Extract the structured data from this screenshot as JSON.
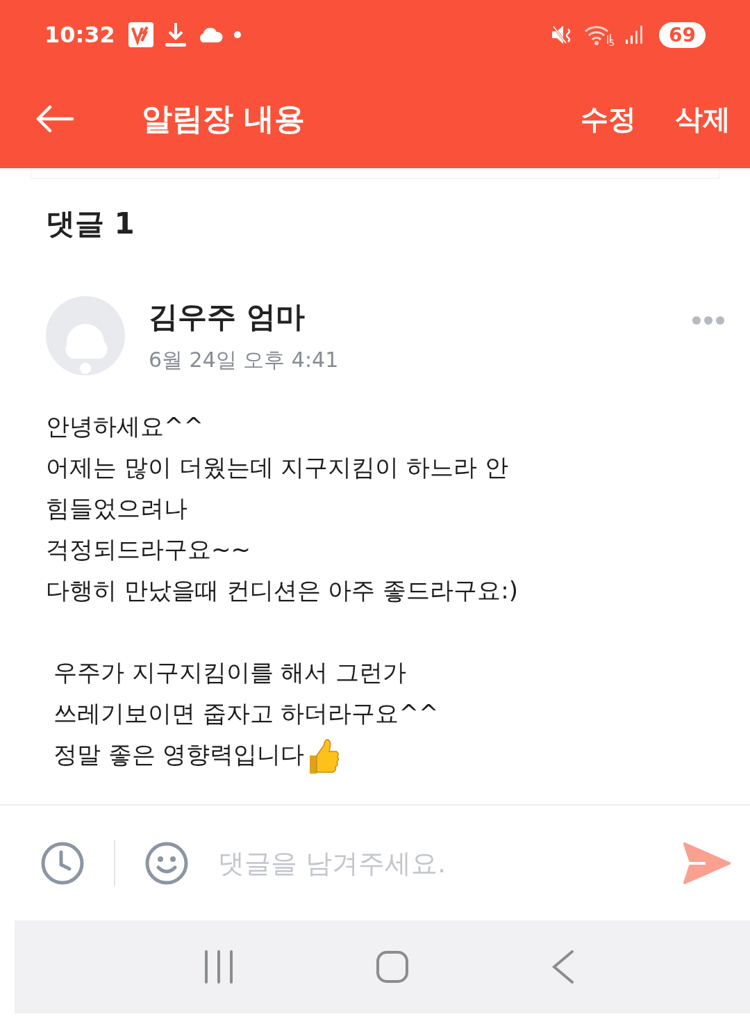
{
  "status_bar": {
    "time": "10:32",
    "battery": "69",
    "wifi_badge": "5"
  },
  "header": {
    "title": "알림장 내용",
    "actions": [
      "수정",
      "삭제"
    ]
  },
  "comments": {
    "heading": "댓글 1",
    "items": [
      {
        "author": "김우주 엄마",
        "date": "6월 24일 오후 4:41",
        "lines": [
          {
            "kind": "text",
            "text": "안녕하세요^^"
          },
          {
            "kind": "text",
            "text": "어제는 많이 더웠는데 지구지킴이 하느라 안"
          },
          {
            "kind": "text",
            "text": "힘들었으려나"
          },
          {
            "kind": "text",
            "text": "걱정되드라구요~~"
          },
          {
            "kind": "text",
            "text": "다행히 만났을때 컨디션은 아주 좋드라구요:)"
          },
          {
            "kind": "blank"
          },
          {
            "kind": "text",
            "text": " 우주가 지구지킴이를 해서 그런가"
          },
          {
            "kind": "text",
            "text": " 쓰레기보이면 줍자고 하더라구요^^"
          },
          {
            "kind": "text_thumbs_up",
            "text": " 정말 좋은 영향력입니다"
          }
        ]
      }
    ]
  },
  "composer": {
    "placeholder": "댓글을 남겨주세요."
  }
}
